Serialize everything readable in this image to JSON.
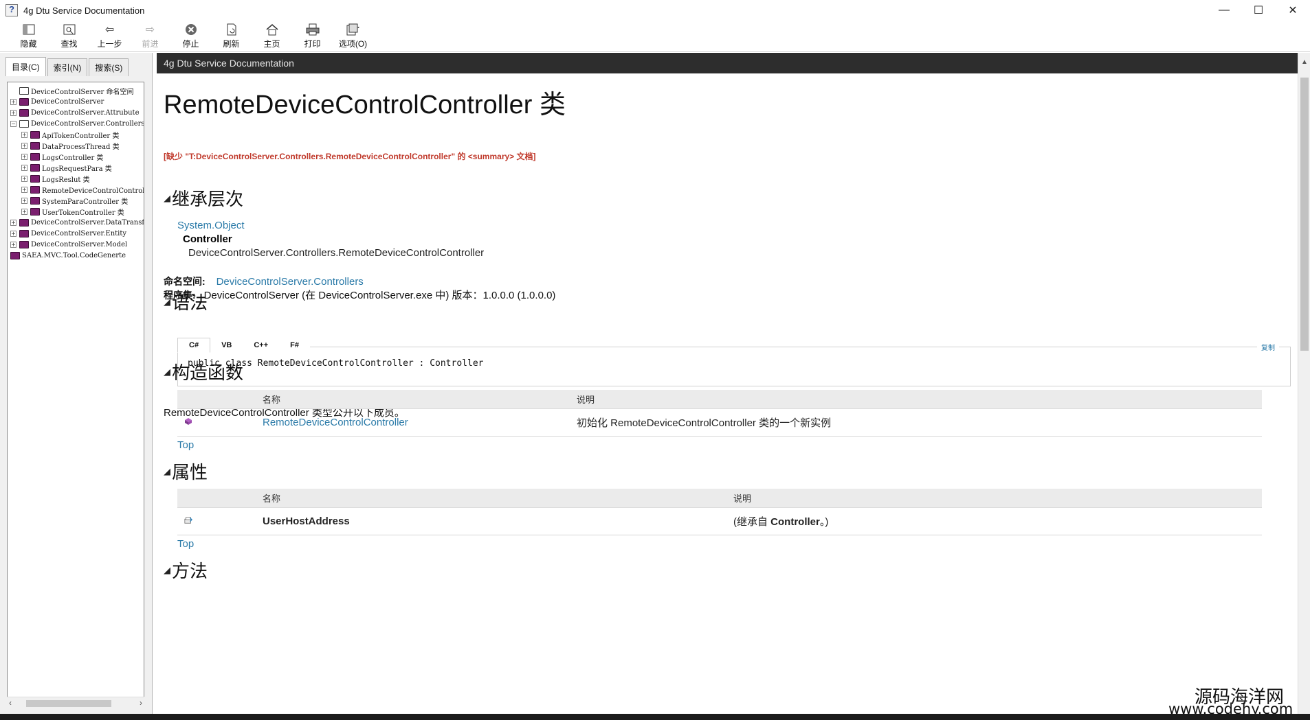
{
  "window": {
    "title": "4g Dtu Service Documentation",
    "controls": {
      "minimize": "—",
      "maximize": "☐",
      "close": "✕"
    }
  },
  "toolbar": {
    "items": [
      {
        "label": "隐藏",
        "icon": "hide-pane-icon"
      },
      {
        "label": "查找",
        "icon": "find-icon"
      },
      {
        "label": "上一步",
        "icon": "back-arrow-icon"
      },
      {
        "label": "前进",
        "icon": "forward-arrow-icon",
        "disabled": true
      },
      {
        "label": "停止",
        "icon": "stop-icon"
      },
      {
        "label": "刷新",
        "icon": "refresh-icon"
      },
      {
        "label": "主页",
        "icon": "home-icon"
      },
      {
        "label": "打印",
        "icon": "print-icon"
      },
      {
        "label": "选项(O)",
        "icon": "options-icon"
      }
    ]
  },
  "nav_tabs": [
    "目录(C)",
    "索引(N)",
    "搜索(S)"
  ],
  "tree": [
    {
      "label": "DeviceControlServer 命名空间",
      "level": 0,
      "expander": "",
      "book": "open"
    },
    {
      "label": "DeviceControlServer",
      "level": 0,
      "expander": "+",
      "book": "closed"
    },
    {
      "label": "DeviceControlServer.Attrubute",
      "level": 0,
      "expander": "+",
      "book": "closed"
    },
    {
      "label": "DeviceControlServer.Controllers",
      "level": 0,
      "expander": "−",
      "book": "open"
    },
    {
      "label": "ApiTokenController 类",
      "level": 1,
      "expander": "+",
      "book": "closed"
    },
    {
      "label": "DataProcessThread 类",
      "level": 1,
      "expander": "+",
      "book": "closed"
    },
    {
      "label": "LogsController 类",
      "level": 1,
      "expander": "+",
      "book": "closed"
    },
    {
      "label": "LogsRequestPara 类",
      "level": 1,
      "expander": "+",
      "book": "closed"
    },
    {
      "label": "LogsReslut 类",
      "level": 1,
      "expander": "+",
      "book": "closed"
    },
    {
      "label": "RemoteDeviceControlController 类",
      "level": 1,
      "expander": "+",
      "book": "closed"
    },
    {
      "label": "SystemParaController 类",
      "level": 1,
      "expander": "+",
      "book": "closed"
    },
    {
      "label": "UserTokenController 类",
      "level": 1,
      "expander": "+",
      "book": "closed"
    },
    {
      "label": "DeviceControlServer.DataTransfer",
      "level": 0,
      "expander": "+",
      "book": "closed"
    },
    {
      "label": "DeviceControlServer.Entity",
      "level": 0,
      "expander": "+",
      "book": "closed"
    },
    {
      "label": "DeviceControlServer.Model",
      "level": 0,
      "expander": "+",
      "book": "closed"
    },
    {
      "label": "SAEA.MVC.Tool.CodeGenerte",
      "level": -1,
      "expander": "",
      "book": "closed"
    }
  ],
  "content": {
    "banner": "4g Dtu Service Documentation",
    "page_title": "RemoteDeviceControlController 类",
    "missing_summary": "[缺少 \"T:DeviceControlServer.Controllers.RemoteDeviceControlController\" 的 <summary> 文档]",
    "inheritance": {
      "heading": "继承层次",
      "object": "System.Object",
      "controller": "Controller",
      "class": "DeviceControlServer.Controllers.RemoteDeviceControlController"
    },
    "namespace": {
      "label": "命名空间:",
      "value": "DeviceControlServer.Controllers"
    },
    "assembly": {
      "label": "程序集:",
      "value": "DeviceControlServer (在 DeviceControlServer.exe 中) 版本：1.0.0.0 (1.0.0.0)"
    },
    "syntax": {
      "heading": "语法",
      "tabs": [
        "C#",
        "VB",
        "C++",
        "F#"
      ],
      "copy": "复制",
      "code": "public class RemoteDeviceControlController : Controller"
    },
    "exposes": "RemoteDeviceControlController 类型公开以下成员。",
    "constructors": {
      "heading": "构造函数",
      "col_name": "名称",
      "col_desc": "说明",
      "rows": [
        {
          "name": "RemoteDeviceControlController",
          "desc": "初始化 RemoteDeviceControlController 类的一个新实例"
        }
      ]
    },
    "properties": {
      "heading": "属性",
      "col_name": "名称",
      "col_desc": "说明",
      "rows": [
        {
          "name": "UserHostAddress",
          "desc_prefix": "(继承自 ",
          "desc_bold": "Controller",
          "desc_suffix": "。)"
        }
      ]
    },
    "top_link": "Top",
    "methods_heading": "方法"
  },
  "watermark": {
    "line1": "源码海洋网",
    "line2": "www.codehy.com"
  },
  "colors": {
    "banner_bg": "#2d2d2d",
    "link": "#2a7aa8",
    "missing": "#c0392b",
    "book_closed": "#7a1e6e"
  }
}
